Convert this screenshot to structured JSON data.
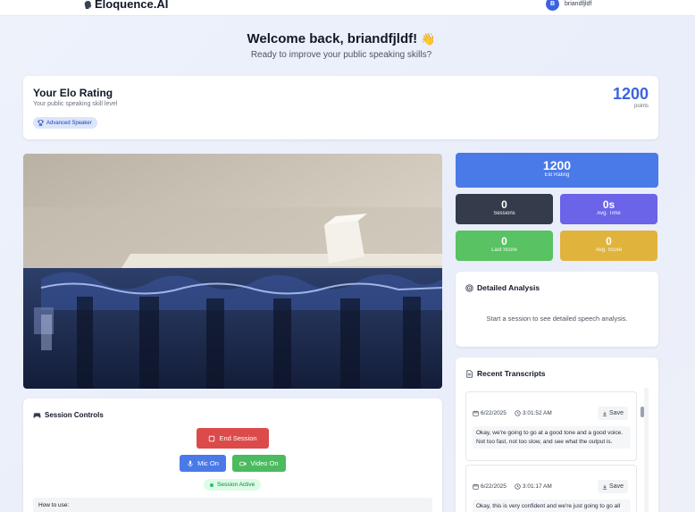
{
  "header": {
    "brand_name": "Eloquence.AI",
    "user_initial": "B",
    "username": "briandfjldf"
  },
  "welcome": {
    "title": "Welcome back, briandfjldf!",
    "emoji": "👋",
    "subtitle": "Ready to improve your public speaking skills?"
  },
  "elo_card": {
    "title": "Your Elo Rating",
    "subtitle": "Your public speaking skill level",
    "badge": "Advanced Speaker",
    "points": "1200",
    "points_label": "points"
  },
  "session_controls": {
    "title": "Session Controls",
    "end_label": "End Session",
    "mic_label": "Mic On",
    "video_label": "Video On",
    "status": "Session Active",
    "howto": "How to use:"
  },
  "stats": {
    "elo": {
      "value": "1200",
      "label": "Elo Rating"
    },
    "sessions": {
      "value": "0",
      "label": "Sessions"
    },
    "avg_time": {
      "value": "0s",
      "label": "Avg. Time"
    },
    "last_score": {
      "value": "0",
      "label": "Last Score"
    },
    "avg_score": {
      "value": "0",
      "label": "Avg. Score"
    }
  },
  "analysis": {
    "title": "Detailed Analysis",
    "empty_text": "Start a session to see detailed speech analysis."
  },
  "transcripts": {
    "title": "Recent Transcripts",
    "save_label": "Save",
    "items": [
      {
        "date": "6/22/2025",
        "time": "3:01:52 AM",
        "text": "Okay, we're going to go at a good tone and a good voice. Not too fast, not too slow, and see what the output is."
      },
      {
        "date": "6/22/2025",
        "time": "3:01:17 AM",
        "text": "Okay, this is very confident and we're just going to go all out in this one and make sure we're delivering"
      }
    ]
  },
  "colors": {
    "brand_blue": "#3b63e0",
    "end_red": "#dc4a4a",
    "mic_blue": "#4a7ae8",
    "video_green": "#4cbb5f",
    "sessions_dark": "#343b4a",
    "avg_time_purple": "#6b63e8",
    "last_score_green": "#59c262",
    "avg_score_yellow": "#e0b33c"
  }
}
